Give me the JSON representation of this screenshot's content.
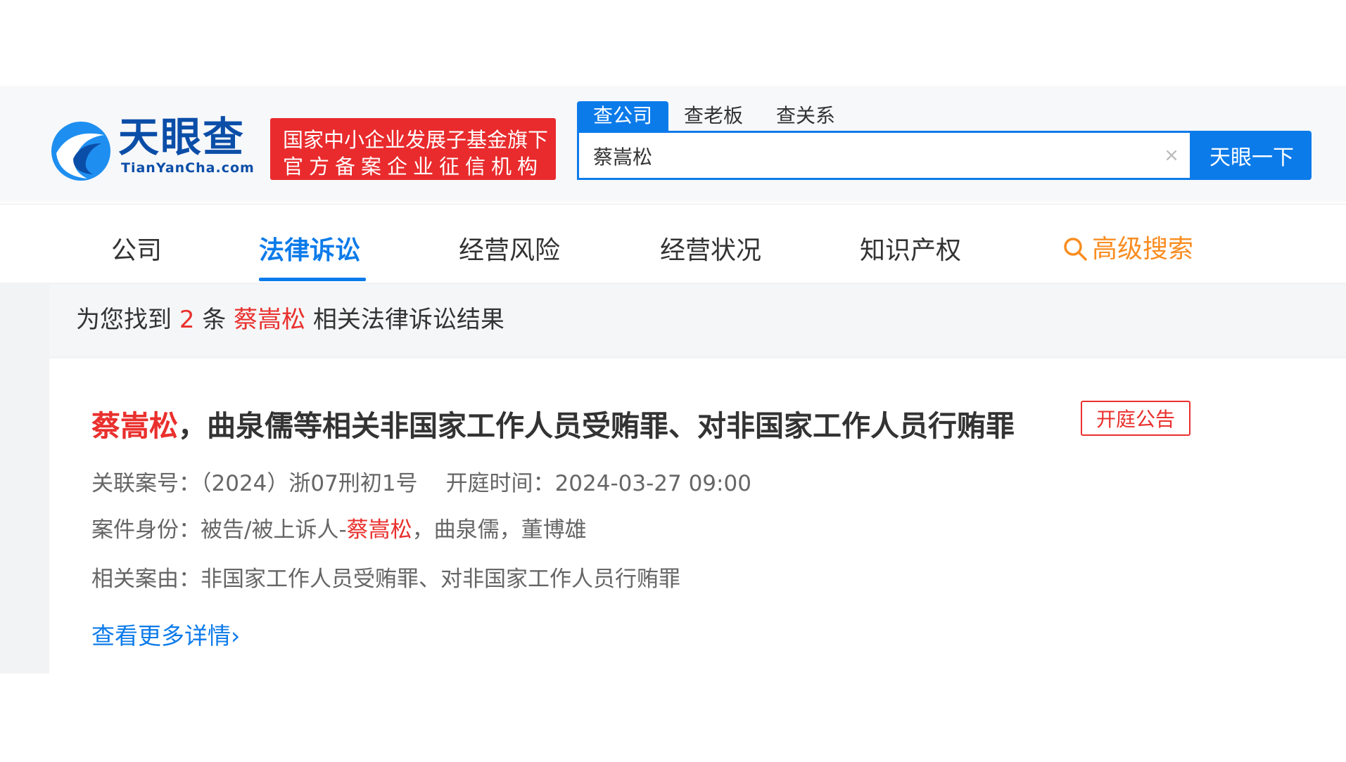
{
  "brand": {
    "name": "天眼查",
    "domain": "TianYanCha.com",
    "badge_line1": "国家中小企业发展子基金旗下",
    "badge_line2": "官方备案企业征信机构"
  },
  "search": {
    "tabs": [
      "查公司",
      "查老板",
      "查关系"
    ],
    "query": "蔡嵩松",
    "button_label": "天眼一下"
  },
  "nav": {
    "items": [
      "公司",
      "法律诉讼",
      "经营风险",
      "经营状况",
      "知识产权"
    ],
    "active": "法律诉讼",
    "advanced_search": "高级搜索"
  },
  "summary": {
    "prefix": "为您找到",
    "count": "2",
    "unit": "条",
    "keyword": "蔡嵩松",
    "suffix": "相关法律诉讼结果"
  },
  "result": {
    "title_name": "蔡嵩松",
    "title_rest": "，曲泉儒等相关非国家工作人员受贿罪、对非国家工作人员行贿罪",
    "tag": "开庭公告",
    "case_no_label": "关联案号：",
    "case_no": "（2024）浙07刑初1号",
    "time_label": "开庭时间：",
    "time": "2024-03-27 09:00",
    "role_label": "案件身份：",
    "role_prefix": "被告/被上诉人-",
    "role_name": "蔡嵩松",
    "role_rest": "，曲泉儒，董博雄",
    "cause_label": "相关案由：",
    "cause": "非国家工作人员受贿罪、对非国家工作人员行贿罪",
    "more": "查看更多详情"
  },
  "colors": {
    "primary": "#0c7bea",
    "red": "#e9302d",
    "orange": "#f98d21",
    "logo": "#0b4ea8"
  }
}
